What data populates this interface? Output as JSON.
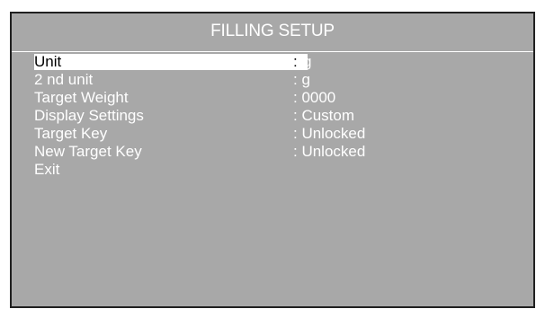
{
  "title": "FILLING SETUP",
  "colors": {
    "screen_bg": "#a8a8a8",
    "text": "#ffffff",
    "highlight": "#ffffff",
    "highlight_text": "#000000"
  },
  "menu": {
    "selected_index": 0,
    "items": [
      {
        "label": "Unit",
        "value": "g"
      },
      {
        "label": "2 nd unit",
        "value": ": g"
      },
      {
        "label": "Target Weight",
        "value": ": 0000"
      },
      {
        "label": "Display Settings",
        "value": ": Custom"
      },
      {
        "label": "Target Key",
        "value": ": Unlocked"
      },
      {
        "label": "New Target Key",
        "value": ": Unlocked"
      },
      {
        "label": "Exit",
        "value": ""
      }
    ],
    "selected_colon": ":"
  }
}
